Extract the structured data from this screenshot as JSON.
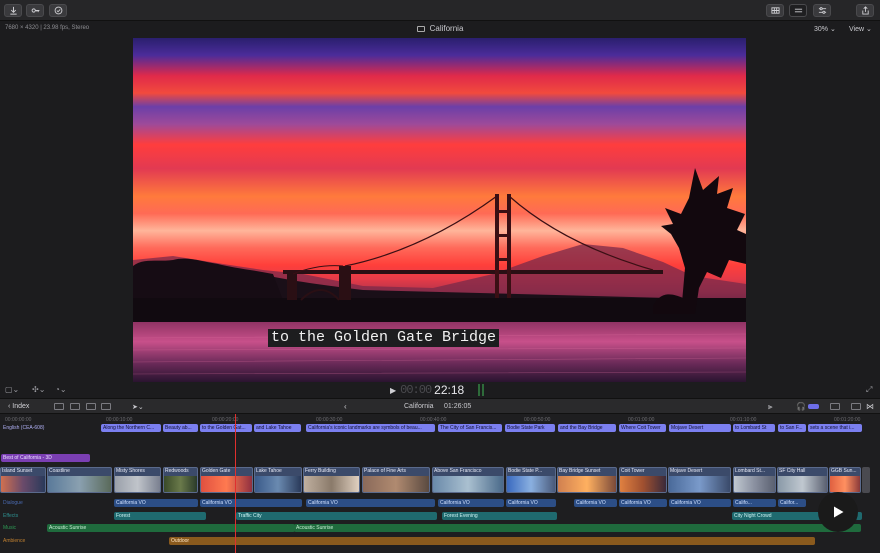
{
  "viewer": {
    "info": "7680 × 4320 | 23.98 fps, Stereo",
    "title": "California",
    "zoom": "30%",
    "view_label": "View",
    "subtitle": "to the Golden Gate Bridge"
  },
  "transport": {
    "ghost_digits": "00:00",
    "timecode": "22:18"
  },
  "timeline_header": {
    "index_label": "Index",
    "project": "California",
    "duration": "01:26:05"
  },
  "ruler": [
    "00:00:00:00",
    "00:00:10:00",
    "00:00:20:00",
    "00:00:30:00",
    "00:00:40:00",
    "00:00:50:00",
    "00:01:00:00",
    "00:01:10:00",
    "00:01:20:00"
  ],
  "captions": {
    "lane_label": "English (CEA-608)",
    "items": [
      "Along the Northern C...",
      "Beauty ab...",
      "to the Golden Gat...",
      "and Lake Tahoe",
      "California's iconic landmarks  are symbols of beau...",
      "The City of San Francis...",
      "Bodie State Park",
      "and the Bay Bridge",
      "Where Coit Tower",
      "Mojave Desert",
      "to Lombard St",
      "to San F...",
      "sets a scene that i..."
    ]
  },
  "title_clip": "Best of California - 3D",
  "video_clips": [
    "Island Sunset",
    "Coastline",
    "Misty Shores",
    "Redwoods",
    "Golden Gate",
    "Lake Tahoe",
    "Ferry Building",
    "Palace of Fine Arts",
    "Above San Francisco",
    "Bodie State P...",
    "Bay Bridge Sunset",
    "Coit Tower",
    "Mojave Desert",
    "Lombard St...",
    "SF City Hall",
    "GGB Sun..."
  ],
  "audio_roles": {
    "dialogue": "Dialogue",
    "effects": "Effects",
    "music": "Music",
    "ambience": "Ambience"
  },
  "dialogue_clips": [
    "California VO",
    "California VO",
    "California VO",
    "California VO",
    "California VO",
    "California VO",
    "California VO",
    "California VO",
    "Califo...",
    "Califor..."
  ],
  "effects_clips": [
    "Forest",
    "Traffic City",
    "Forest Evening",
    "City Night Crowd"
  ],
  "music_clips": [
    "Acoustic Sunrise",
    "Acoustic Sunrise"
  ],
  "ambience_clips": [
    "Outdoor"
  ],
  "colors": {
    "caption": "#7b7ff0",
    "dialogue": "#2c4e86",
    "effects": "#1f6a6f",
    "music": "#1f6b3d",
    "ambience": "#8a5a1d",
    "playhead": "#e0302e"
  }
}
